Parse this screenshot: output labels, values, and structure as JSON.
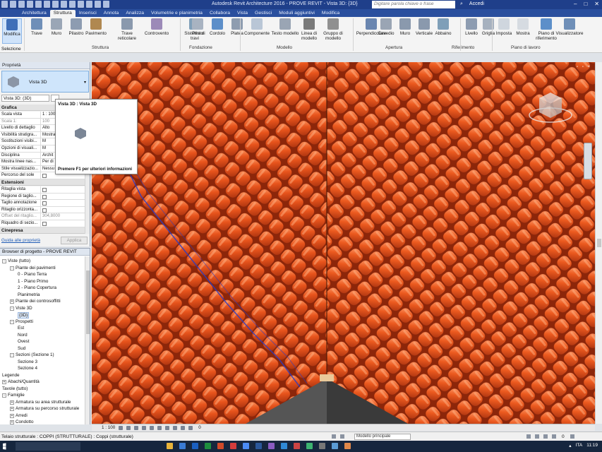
{
  "titlebar": {
    "title": "Autodesk Revit Architecture 2016 -    PROVE REVIT - Vista 3D: {3D}",
    "search_placeholder": "Digitare parola chiave o frase",
    "sign_in": "Accedi"
  },
  "tabs": {
    "file": "",
    "items": [
      "Architettura",
      "Struttura",
      "Inserisci",
      "Annota",
      "Analizza",
      "Volumetrie e planimetria",
      "Collabora",
      "Vista",
      "Gestisci",
      "Moduli aggiuntivi",
      "Modifica"
    ],
    "active": "Struttura"
  },
  "ribbon": {
    "modify": "Modifica",
    "selezione": "Selezione",
    "struttura_buttons": [
      "Trave",
      "Muro",
      "Pilastro",
      "Pavimento",
      "Trave reticolare",
      "Controvento",
      "Sistema di travi"
    ],
    "fondazione_buttons": [
      "Plinto",
      "Cordolo",
      "Platea"
    ],
    "modello_buttons": [
      "Componente",
      "Testo modello",
      "Linea di modello",
      "Gruppo di modello"
    ],
    "apertura_buttons": [
      "Perpendicolare",
      "Cavedio",
      "Muro",
      "Verticale",
      "Abbaino"
    ],
    "riferimento_buttons": [
      "Livello",
      "Griglia"
    ],
    "pianolavoro_buttons": [
      "Imposta",
      "Mostra",
      "Piano di riferimento",
      "Visualizzatore"
    ],
    "groups": [
      "Struttura",
      "Fondazione",
      "Modello",
      "Apertura",
      "Riferimento",
      "Piano di lavoro"
    ]
  },
  "properties": {
    "title": "Proprietà",
    "type_name": "Vista 3D",
    "view_selector": "Vista 3D: (3D)",
    "edit_type": "Modifica tipo",
    "sections": {
      "grafica": "Grafica",
      "estensioni": "Estensioni",
      "cinepresa": "Cinepresa"
    },
    "rows_grafica": [
      {
        "k": "Scala vista",
        "v": "1 : 100",
        "gray": false
      },
      {
        "k": "Scala  1:",
        "v": "100",
        "gray": true
      },
      {
        "k": "Livello di dettaglio",
        "v": "Alto",
        "gray": false
      },
      {
        "k": "Visibilità stratigra...",
        "v": "Mostra",
        "gray": false
      },
      {
        "k": "Sostituzioni visibi...",
        "v": "M",
        "gray": false
      },
      {
        "k": "Opzioni di visuali...",
        "v": "M",
        "gray": false
      },
      {
        "k": "Disciplina",
        "v": "Archit",
        "gray": false
      },
      {
        "k": "Mostra linee nas...",
        "v": "Per di",
        "gray": false
      },
      {
        "k": "Stile visualizzazio...",
        "v": "Nessu",
        "gray": false
      },
      {
        "k": "Percorso del sole",
        "v": "",
        "gray": false
      }
    ],
    "rows_estensioni": [
      {
        "k": "Ritaglia vista",
        "v": "",
        "gray": false
      },
      {
        "k": "Regione di taglio...",
        "v": "",
        "gray": false
      },
      {
        "k": "Taglio annotazione",
        "v": "",
        "gray": false
      },
      {
        "k": "Ritaglio orizzonta...",
        "v": "",
        "gray": false
      },
      {
        "k": "Offset del ritaglio...",
        "v": "304,8000",
        "gray": true
      },
      {
        "k": "Riquadro di sezio...",
        "v": "",
        "gray": false
      }
    ],
    "help_link": "Guida alle proprietà",
    "apply": "Applica"
  },
  "tooltip": {
    "title": "Vista 3D : Vista 3D",
    "hint": "Premere F1 per ulteriori informazioni"
  },
  "browser": {
    "title": "Browser di progetto - PROVE REVIT",
    "nodes": [
      {
        "label": "Viste (tutto)",
        "lvl": 0,
        "tog": "-"
      },
      {
        "label": "Piante dei pavimenti",
        "lvl": 1,
        "tog": "-"
      },
      {
        "label": "0 - Piano Terra",
        "lvl": 2,
        "tog": ""
      },
      {
        "label": "1 - Piano Primo",
        "lvl": 2,
        "tog": ""
      },
      {
        "label": "2 - Piano Copertura",
        "lvl": 2,
        "tog": ""
      },
      {
        "label": "Planimetria",
        "lvl": 2,
        "tog": ""
      },
      {
        "label": "Piante dei controsoffitti",
        "lvl": 1,
        "tog": "+"
      },
      {
        "label": "Viste 3D",
        "lvl": 1,
        "tog": "-"
      },
      {
        "label": "{3D}",
        "lvl": 2,
        "tog": "",
        "hl": true
      },
      {
        "label": "Prospetti",
        "lvl": 1,
        "tog": "-"
      },
      {
        "label": "Est",
        "lvl": 2,
        "tog": ""
      },
      {
        "label": "Nord",
        "lvl": 2,
        "tog": ""
      },
      {
        "label": "Ovest",
        "lvl": 2,
        "tog": ""
      },
      {
        "label": "Sud",
        "lvl": 2,
        "tog": ""
      },
      {
        "label": "Sezioni (Sezione 1)",
        "lvl": 1,
        "tog": "-"
      },
      {
        "label": "Sezione 3",
        "lvl": 2,
        "tog": ""
      },
      {
        "label": "Sezione 4",
        "lvl": 2,
        "tog": ""
      },
      {
        "label": "Legende",
        "lvl": 0,
        "tog": ""
      },
      {
        "label": "Abachi/Quantità",
        "lvl": 0,
        "tog": "+"
      },
      {
        "label": "Tavole (tutto)",
        "lvl": 0,
        "tog": ""
      },
      {
        "label": "Famiglie",
        "lvl": 0,
        "tog": "-"
      },
      {
        "label": "Armatura su area strutturale",
        "lvl": 1,
        "tog": "+"
      },
      {
        "label": "Armatura su percorso strutturale",
        "lvl": 1,
        "tog": "+"
      },
      {
        "label": "Arredi",
        "lvl": 1,
        "tog": "+"
      },
      {
        "label": "Condotto",
        "lvl": 1,
        "tog": "+"
      }
    ]
  },
  "viewbar": {
    "scale": "1 : 100",
    "right_num": "0"
  },
  "status": {
    "text": "Telaio strutturale : COPPI (STRUTTURALE) : Coppi (strutturale)",
    "model": "Modello principale",
    "right_num": "0"
  },
  "taskbar": {
    "search": "",
    "lang": "ITA",
    "time": "11:19"
  },
  "colors": {
    "tile": "#e8541c",
    "tile_shadow": "#9e2a0c",
    "tile_highlight": "#ff9f6a",
    "ribbon_bg": "#f4f4f4",
    "title_bg": "#1f3f8a"
  }
}
